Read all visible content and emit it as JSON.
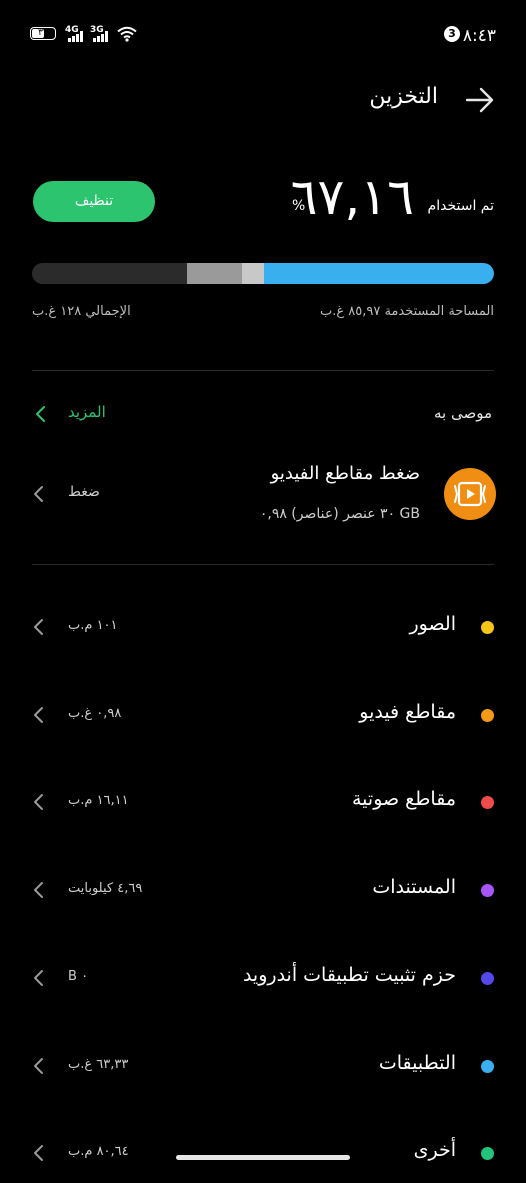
{
  "status_bar": {
    "time": "٨:٤٣",
    "notification_count": "3",
    "battery_level": "٣٣",
    "network_1": "4G",
    "network_2": "3G"
  },
  "header": {
    "title": "التخزين",
    "back_icon": "arrow-right-icon"
  },
  "usage": {
    "used_label": "تم استخدام",
    "used_value": "٦٧,١٦",
    "percent_sign": "%",
    "clean_button": "تنظيف",
    "used_space_label": "المساحة المستخدمة ٨٥,٩٧ غ.ب",
    "total_label": "الإجمالي ١٢٨ غ.ب",
    "bar_segments": [
      {
        "name": "apps",
        "color": "#3aaff0",
        "fraction": 0.497
      },
      {
        "name": "other-light",
        "color": "#c8c8c8",
        "fraction": 0.048
      },
      {
        "name": "other-gray",
        "color": "#9a9a9a",
        "fraction": 0.12
      }
    ]
  },
  "recommended": {
    "label": "موصى به",
    "more_label": "المزيد",
    "item_title": "ضغط مقاطع الفيديو",
    "item_subtitle": "٣٠ عنصر (عناصر) ٠,٩٨ GB",
    "item_action": "ضغط",
    "item_icon": "video-compress-icon",
    "icon_color": "#f08d13"
  },
  "categories": [
    {
      "label": "الصور",
      "value": "١٠١ م.ب",
      "color": "#f5c518"
    },
    {
      "label": "مقاطع فيديو",
      "value": "٠,٩٨ غ.ب",
      "color": "#f59a16"
    },
    {
      "label": "مقاطع صوتية",
      "value": "١٦,١١ م.ب",
      "color": "#ef4b4b"
    },
    {
      "label": "المستندات",
      "value": "٤,٦٩ كيلوبايت",
      "color": "#a855f7"
    },
    {
      "label": "حزم تثبيت تطبيقات أندرويد",
      "value": "B ٠",
      "color": "#5548e8"
    },
    {
      "label": "التطبيقات",
      "value": "٦٣,٣٣ غ.ب",
      "color": "#3aaff0"
    },
    {
      "label": "أخرى",
      "value": "٨٠,٦٤ م.ب",
      "color": "#22c37a"
    }
  ]
}
